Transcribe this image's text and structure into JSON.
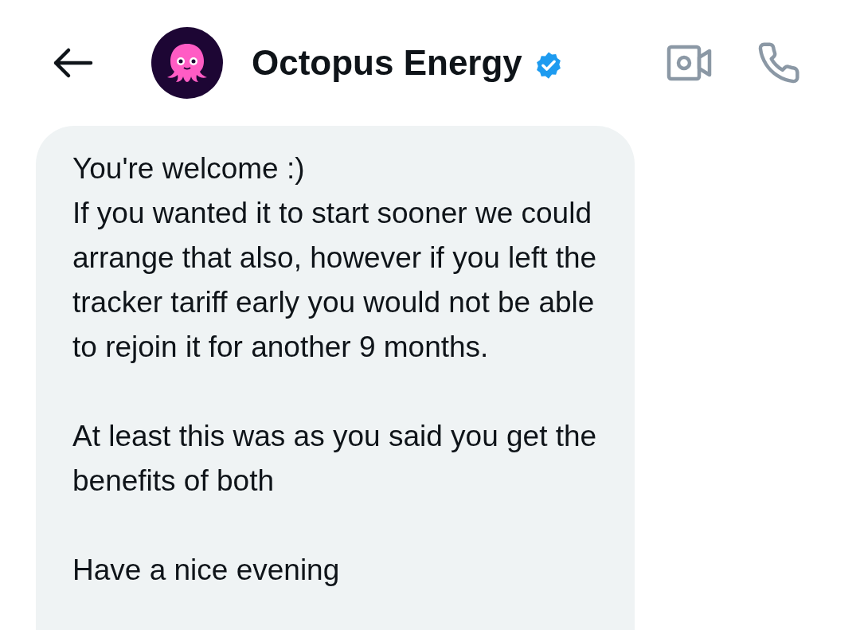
{
  "header": {
    "name": "Octopus Energy",
    "verified": true
  },
  "message": {
    "paragraphs": [
      "You're welcome :)\nIf you wanted it to start sooner we could arrange that also, however if you left the tracker tariff early you would not be able to rejoin it for another 9 months.",
      "At least this was as you said you get the benefits of both",
      "Have a nice evening"
    ]
  }
}
